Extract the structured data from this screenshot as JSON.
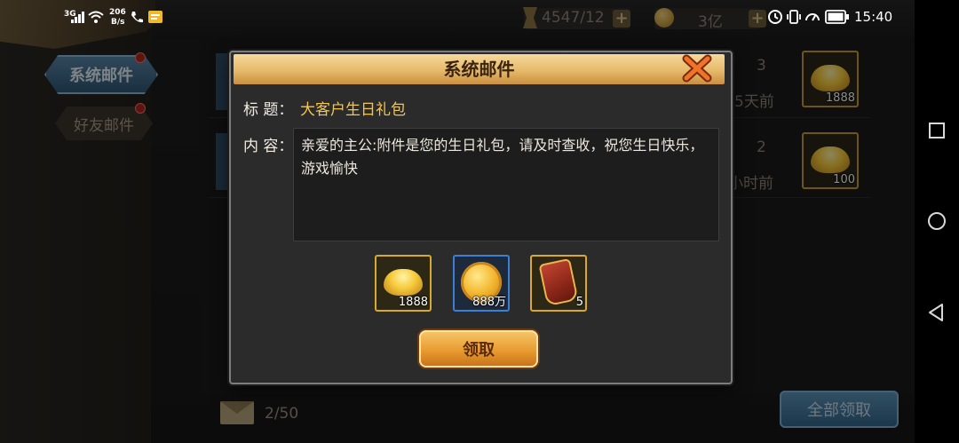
{
  "status_bar": {
    "signal": "3G",
    "net_speed_value": "206",
    "net_speed_unit": "B/s",
    "time": "15:40"
  },
  "top_bar": {
    "stamina": "4547/12",
    "ingots": "3亿"
  },
  "tabs": [
    {
      "label": "系统邮件",
      "active": true
    },
    {
      "label": "好友邮件",
      "active": false
    }
  ],
  "mail_list": [
    {
      "count": "3",
      "time": "5天前",
      "item_qty": "1888"
    },
    {
      "count": "2",
      "time": "小时前",
      "item_qty": "100"
    }
  ],
  "footer": {
    "mail_count": "2/50",
    "claim_all_label": "全部领取"
  },
  "dialog": {
    "title": "系统邮件",
    "subject_label": "标 题：",
    "subject": "大客户生日礼包",
    "content_label": "内 容：",
    "content": "亲爱的主公:附件是您的生日礼包，请及时查收，祝您生日快乐，游戏愉快",
    "attachments": [
      {
        "icon": "gold-ingot-icon",
        "qty": "1888"
      },
      {
        "icon": "gold-coin-icon",
        "qty": "888万"
      },
      {
        "icon": "token-icon",
        "qty": "5"
      }
    ],
    "claim_label": "领取"
  },
  "colors": {
    "header_gold": "#e6b96b",
    "subject_yellow": "#f4c64a",
    "claim_orange": "#e89b2f",
    "tab_blue": "#2d5573"
  }
}
